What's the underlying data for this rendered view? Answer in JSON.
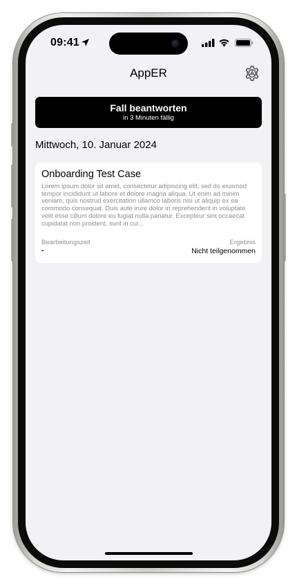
{
  "status_bar": {
    "time": "09:41",
    "location_icon": "location-arrow-icon",
    "signal_icon": "cellular-signal-icon",
    "wifi_icon": "wifi-icon",
    "battery_icon": "battery-icon"
  },
  "nav": {
    "title": "AppER",
    "settings_icon": "gear-icon"
  },
  "primary_button": {
    "title": "Fall beantworten",
    "subtitle": "in 3 Minuten fällig",
    "background": "#000000",
    "text_color": "#ffffff"
  },
  "date_heading": "Mittwoch, 10. Januar 2024",
  "case_card": {
    "title": "Onboarding Test Case",
    "body": "Lorem ipsum dolor sit amet, consectetur adipiscing elit, sed do eiusmod tempor incididunt ut labore et dolore magna aliqua. Ut enim ad minim veniam, quis nostrud exercitation ullamco laboris nisi ut aliquip ex ea commodo consequat. Duis aute irure dolor in reprehenderit in voluptate velit esse cillum dolore eu fugiat nulla pariatur. Excepteur sint occaecat cupidatat non proident, sunt in cul...",
    "left_label": "Bearbeitungszeit",
    "left_value": "-",
    "right_label": "Ergebnis",
    "right_value": "Nicht teilgenommen"
  },
  "colors": {
    "screen_background": "#f2f2f6",
    "card_background": "#ffffff",
    "secondary_text": "#8e8e93"
  }
}
